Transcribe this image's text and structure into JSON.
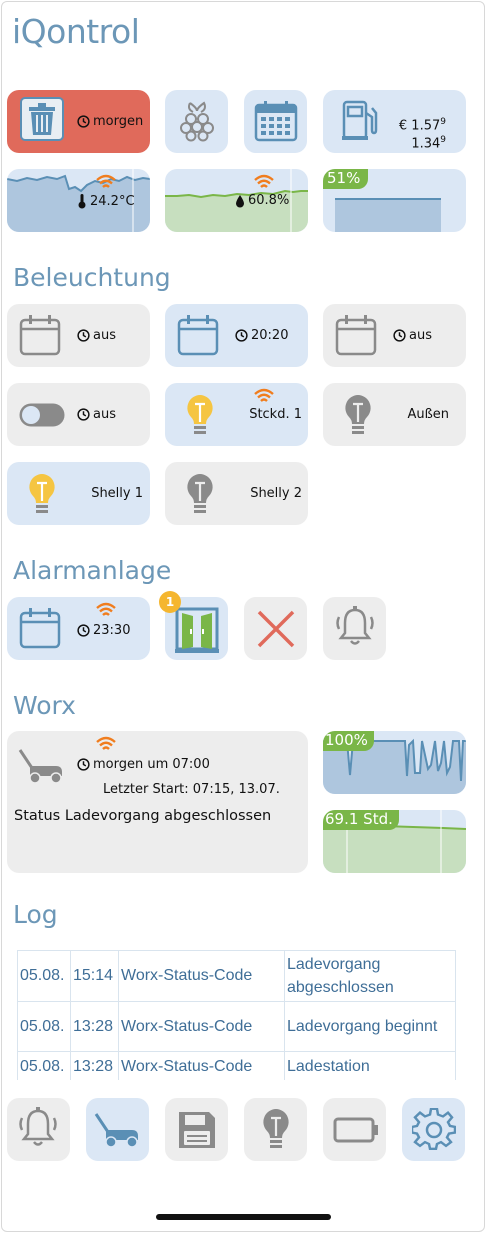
{
  "app": {
    "title": "iQontrol"
  },
  "top_tiles": {
    "trash": {
      "label": "morgen"
    },
    "fuel": {
      "price1": "€ 1.57",
      "price1_sup": "9",
      "price2": "1.34",
      "price2_sup": "9"
    },
    "temperature": {
      "value": "24.2°C"
    },
    "humidity": {
      "value": "60.8%"
    },
    "battery": {
      "value": "51%",
      "level": 0.51
    }
  },
  "sections": {
    "lighting": "Beleuchtung",
    "alarm": "Alarmanlage",
    "worx": "Worx",
    "log": "Log"
  },
  "lighting": {
    "tiles": [
      {
        "label": "aus"
      },
      {
        "label": "20:20"
      },
      {
        "label": "aus"
      },
      {
        "label": "aus"
      },
      {
        "label": "Stckd. 1"
      },
      {
        "label": "Außen"
      },
      {
        "label": "Shelly 1"
      },
      {
        "label": "Shelly 2"
      }
    ]
  },
  "alarm": {
    "schedule_label": "23:30",
    "door_badge": "1"
  },
  "worx": {
    "next": "morgen um 07:00",
    "last_start": "Letzter Start: 07:15, 13.07.",
    "status": "Status Ladevorgang abgeschlossen",
    "battery": "100%",
    "battery_level": 1.0,
    "hours": "69.1 Std."
  },
  "log": {
    "rows": [
      {
        "date": "05.08.",
        "time": "15:14",
        "source": "Worx-Status-Code",
        "message": "Ladevorgang abgeschlossen"
      },
      {
        "date": "05.08.",
        "time": "13:28",
        "source": "Worx-Status-Code",
        "message": "Ladevorgang beginnt"
      },
      {
        "date": "05.08.",
        "time": "13:28",
        "source": "Worx-Status-Code",
        "message": "Ladestation"
      }
    ]
  },
  "bottom_nav": {
    "items": [
      "bell-icon",
      "lawnmower-icon",
      "floppy-icon",
      "bulb-icon",
      "battery-icon",
      "gear-icon"
    ]
  },
  "colors": {
    "accent": "#6c97b7",
    "tile_blue": "#dbe7f5",
    "tile_grey": "#ededed",
    "tile_red": "#e06a5b",
    "badge_green": "#7ab648",
    "wifi_orange": "#f07d1e"
  }
}
